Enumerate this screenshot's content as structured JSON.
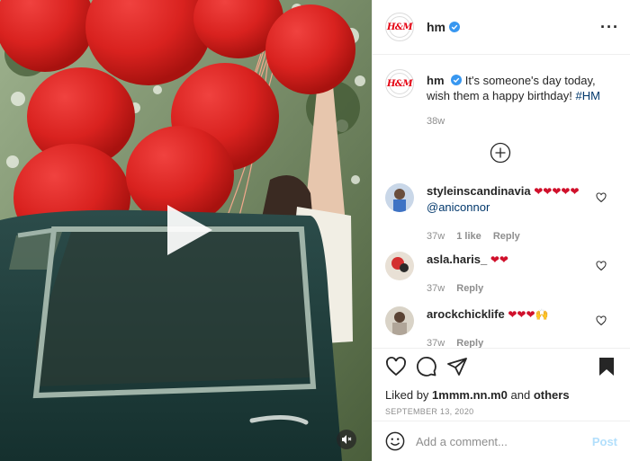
{
  "post": {
    "username": "hm",
    "logo_text": "H&M",
    "verified": true,
    "more_icon": "more-horizontal-icon"
  },
  "caption": {
    "username": "hm",
    "text": "It's someone's day today, wish them a happy birthday!",
    "hashtag": "#HM",
    "age": "38w"
  },
  "comments": [
    {
      "username": "styleinscandinavia",
      "text": "❤❤❤❤❤",
      "mention": "@aniconnor",
      "age": "37w",
      "likes": "1 like",
      "reply": "Reply"
    },
    {
      "username": "asla.haris_",
      "text": "❤❤",
      "age": "37w",
      "reply": "Reply"
    },
    {
      "username": "arockchicklife",
      "text": "❤❤❤🙌",
      "age": "37w",
      "reply": "Reply"
    }
  ],
  "actions": {
    "liked_by_prefix": "Liked by",
    "liked_by_user": "1mmm.nn.m0",
    "liked_by_and": "and",
    "liked_by_others": "others",
    "date": "SEPTEMBER 13, 2020"
  },
  "add_comment": {
    "placeholder": "Add a comment...",
    "post_label": "Post"
  },
  "colors": {
    "brand_red": "#e50010",
    "link_blue": "#00376b",
    "verified_blue": "#3897f0",
    "post_disabled": "#b2dffc"
  }
}
